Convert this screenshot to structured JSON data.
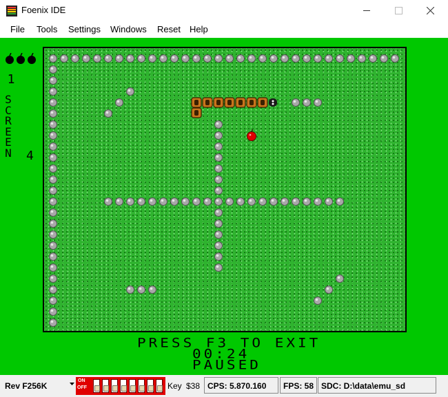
{
  "window": {
    "title": "Foenix IDE"
  },
  "menu": {
    "items": [
      {
        "label": "File"
      },
      {
        "label": "Tools"
      },
      {
        "label": "Settings"
      },
      {
        "label": "Windows"
      },
      {
        "label": "Reset"
      },
      {
        "label": "Help"
      }
    ]
  },
  "game": {
    "lives": 3,
    "level": "1",
    "side_word": "SCREEN",
    "side_number": "4",
    "message_exit": "PRESS F3 TO EXIT",
    "timer": "00:24",
    "status": "PAUSED",
    "colors": {
      "background": "#00c800",
      "field": "#2fb32f",
      "rock": "#a8a8a8",
      "snake": "#c8741c",
      "apple": "#e00000"
    }
  },
  "statusbar": {
    "revision": "Rev F256K",
    "dip_on_label": "ON",
    "dip_off_label": "OFF",
    "dip_switch_count": 8,
    "key_label": "Key",
    "key_value": "$38",
    "cps": "CPS: 5.870.160",
    "fps": "FPS: 58",
    "sdc": "SDC: D:\\data\\emu_sd"
  }
}
